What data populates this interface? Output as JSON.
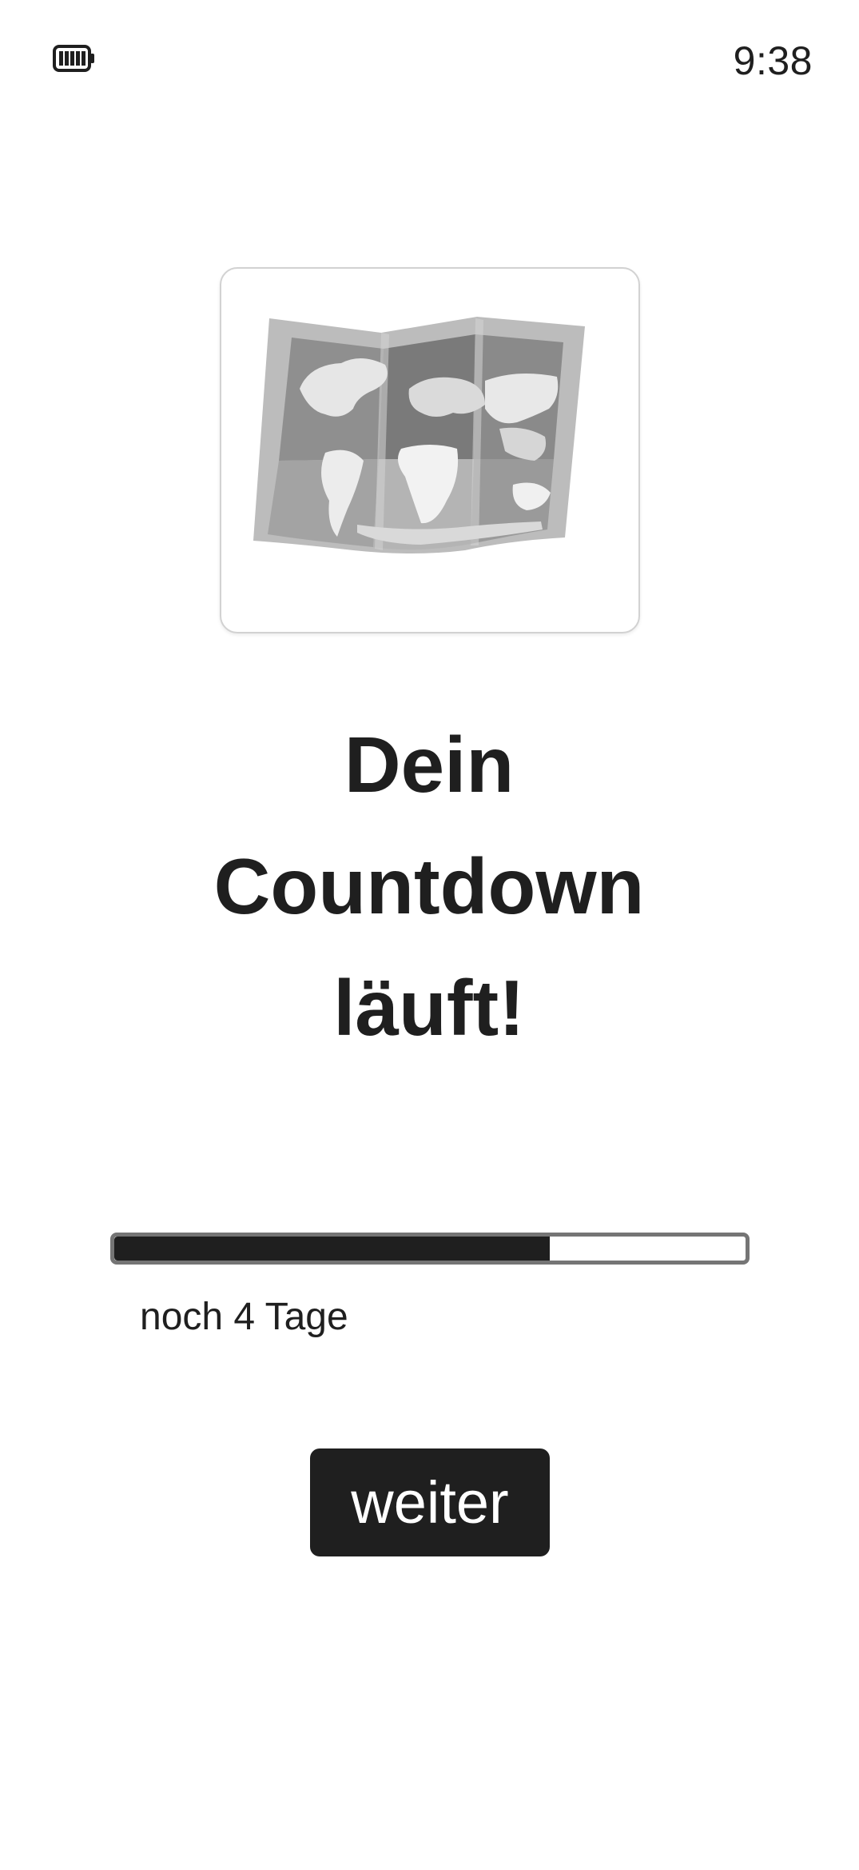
{
  "status_bar": {
    "battery_icon": "battery-full-icon",
    "time": "9:38"
  },
  "hero": {
    "image_icon": "world-map-icon"
  },
  "headline": {
    "lines": [
      "Dein",
      "Countdown",
      "läuft!"
    ]
  },
  "countdown": {
    "progress_fraction": 0.69,
    "label": "noch 4 Tage"
  },
  "actions": {
    "next_label": "weiter"
  },
  "colors": {
    "text": "#1f1f1f",
    "button_bg": "#1f1f1f",
    "button_text": "#ffffff",
    "progress_fill": "#1f1f1f",
    "progress_border": "#757575",
    "card_border": "#d2d2d2"
  }
}
